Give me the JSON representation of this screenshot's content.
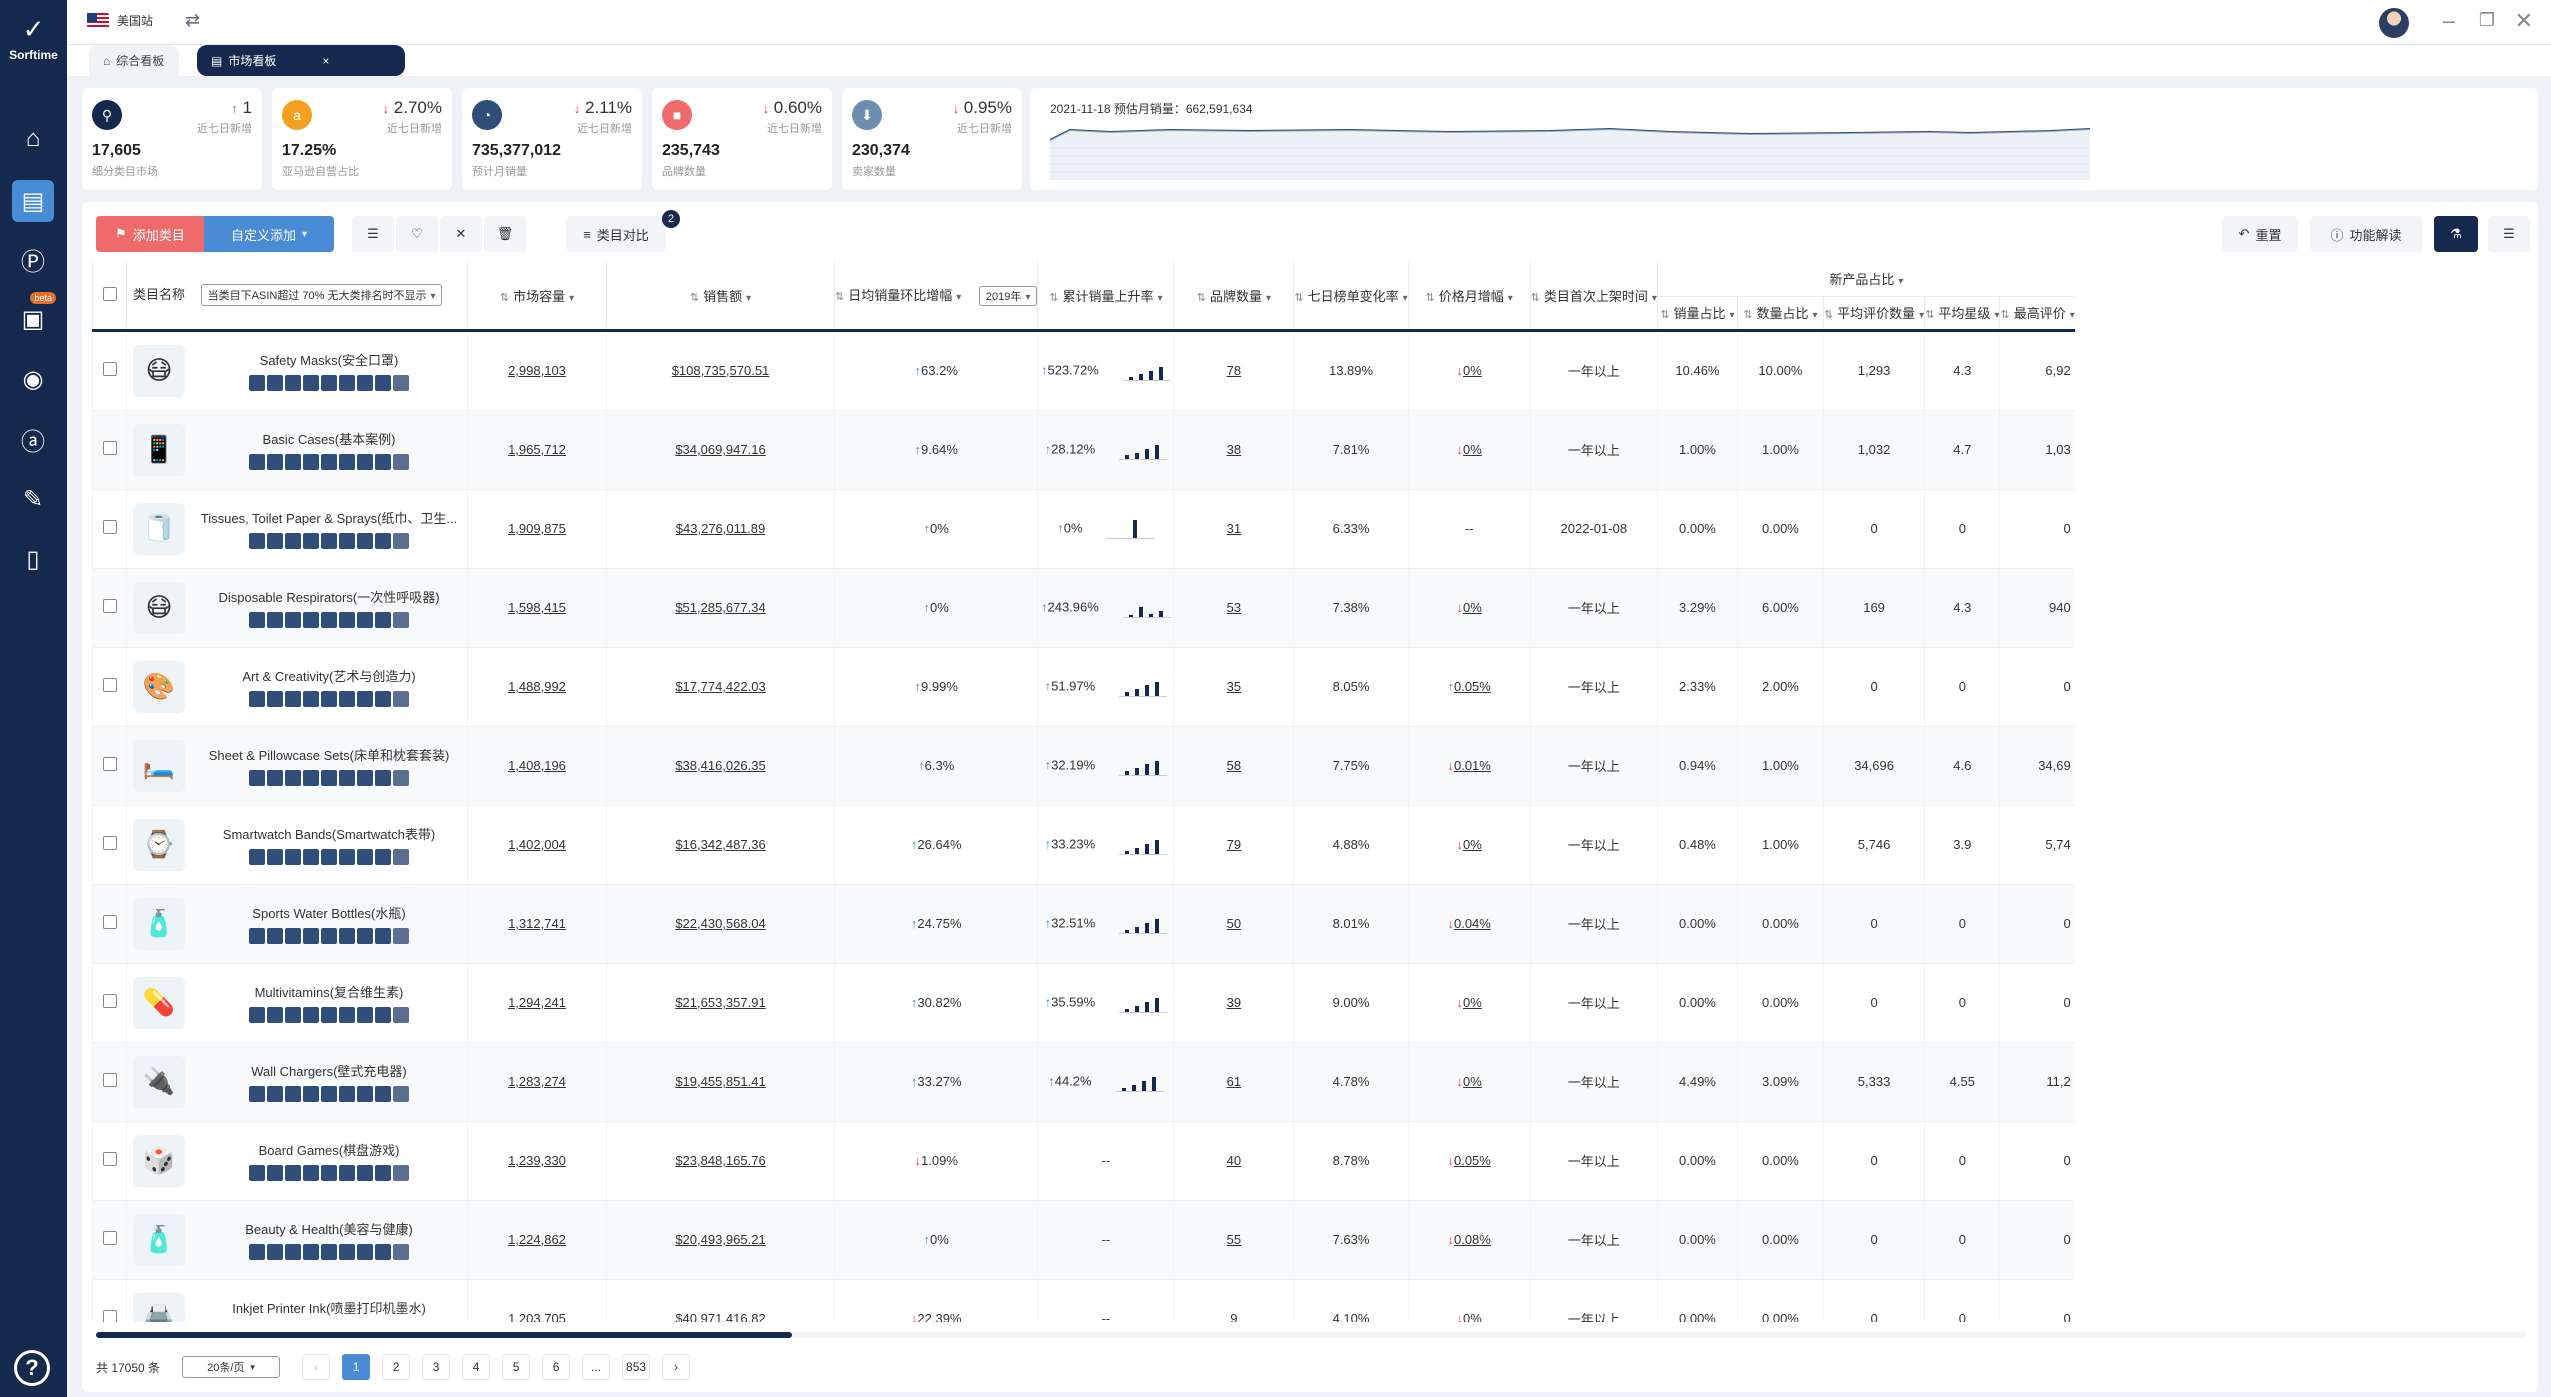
{
  "app": {
    "name": "Sorftime",
    "site": "美国站"
  },
  "tabs": [
    {
      "label": "综合看板"
    },
    {
      "label": "市场看板"
    }
  ],
  "stats": [
    {
      "icon": "market-icon",
      "arrow": "↑",
      "change": "1",
      "change_dir": "up",
      "sub": "近七日新增",
      "value": "17,605",
      "label": "细分类目市场",
      "color": "#15284d"
    },
    {
      "icon": "amazon-icon",
      "arrow": "↓",
      "change": "2.70%",
      "change_dir": "down",
      "sub": "近七日新增",
      "value": "17.25%",
      "label": "亚马逊自营占比",
      "color": "#f4a020"
    },
    {
      "icon": "sales-icon",
      "arrow": "↓",
      "change": "2.11%",
      "change_dir": "down",
      "sub": "近七日新增",
      "value": "735,377,012",
      "label": "预计月销量",
      "color": "#2f4f7a"
    },
    {
      "icon": "brand-icon",
      "arrow": "↓",
      "change": "0.60%",
      "change_dir": "down",
      "sub": "近七日新增",
      "value": "235,743",
      "label": "品牌数量",
      "color": "#ef6b6b"
    },
    {
      "icon": "seller-icon",
      "arrow": "↓",
      "change": "0.95%",
      "change_dir": "down",
      "sub": "近七日新增",
      "value": "230,374",
      "label": "卖家数量",
      "color": "#6d8eb0"
    }
  ],
  "trend": {
    "title": "2021-11-18 预估月销量：662,591,634"
  },
  "toolbar": {
    "add": "添加类目",
    "custom_add": "自定义添加",
    "compare": "类目对比",
    "compare_count": "2",
    "reset": "重置",
    "help": "功能解读"
  },
  "columns": {
    "name": "类目名称",
    "filter": "当类目下ASIN超过 70% 无大类排名时不显示",
    "capacity": "市场容量",
    "sales": "销售额",
    "daily_growth": "日均销量环比增幅",
    "year": "2019年",
    "cum_rate": "累计销量上升率",
    "brands": "品牌数量",
    "rank_change": "七日榜单变化率",
    "price_growth": "价格月增幅",
    "first_listed": "类目首次上架时间",
    "new_group": "新产品占比",
    "sub": [
      "销量占比",
      "数量占比",
      "平均评价数量",
      "平均星级",
      "最高评价"
    ]
  },
  "rows": [
    {
      "name": "Safety Masks(安全口罩)",
      "img": "😷",
      "capacity": "2,998,103",
      "sales": "$108,735,570.51",
      "dg_dir": "up",
      "dg": "63.2%",
      "cr_dir": "up",
      "cr": "523.72%",
      "spark": [
        3,
        6,
        9,
        13
      ],
      "brands": "78",
      "rank": "13.89%",
      "pg_dir": "down",
      "pg": "0%",
      "first": "一年以上",
      "s1": "10.46%",
      "s2": "10.00%",
      "s3": "1,293",
      "s4": "4.3",
      "s5": "6,92"
    },
    {
      "name": "Basic Cases(基本案例)",
      "img": "📱",
      "capacity": "1,965,712",
      "sales": "$34,069,947.16",
      "dg_dir": "up",
      "dg": "9.64%",
      "cr_dir": "up",
      "cr": "28.12%",
      "spark": [
        4,
        6,
        10,
        14
      ],
      "brands": "38",
      "rank": "7.81%",
      "pg_dir": "down",
      "pg": "0%",
      "first": "一年以上",
      "s1": "1.00%",
      "s2": "1.00%",
      "s3": "1,032",
      "s4": "4.7",
      "s5": "1,03"
    },
    {
      "name": "Tissues, Toilet Paper & Sprays(纸巾、卫生...",
      "img": "🧻",
      "capacity": "1,909,875",
      "sales": "$43,276,011.89",
      "dg_dir": "up",
      "dg": "0%",
      "cr_dir": "up",
      "cr": "0%",
      "spark": [
        0,
        0,
        18,
        0
      ],
      "brands": "31",
      "rank": "6.33%",
      "pg_dir": "none",
      "pg": "--",
      "first": "2022-01-08",
      "s1": "0.00%",
      "s2": "0.00%",
      "s3": "0",
      "s4": "0",
      "s5": "0"
    },
    {
      "name": "Disposable Respirators(一次性呼吸器)",
      "img": "😷",
      "capacity": "1,598,415",
      "sales": "$51,285,677.34",
      "dg_dir": "up",
      "dg": "0%",
      "cr_dir": "up",
      "cr": "243.96%",
      "spark": [
        2,
        10,
        3,
        6
      ],
      "brands": "53",
      "rank": "7.38%",
      "pg_dir": "down",
      "pg": "0%",
      "first": "一年以上",
      "s1": "3.29%",
      "s2": "6.00%",
      "s3": "169",
      "s4": "4.3",
      "s5": "940"
    },
    {
      "name": "Art & Creativity(艺术与创造力)",
      "img": "🎨",
      "capacity": "1,488,992",
      "sales": "$17,774,422.03",
      "dg_dir": "up",
      "dg": "9.99%",
      "cr_dir": "up",
      "cr": "51.97%",
      "spark": [
        4,
        7,
        11,
        14
      ],
      "brands": "35",
      "rank": "8.05%",
      "pg_dir": "up",
      "pg": "0.05%",
      "first": "一年以上",
      "s1": "2.33%",
      "s2": "2.00%",
      "s3": "0",
      "s4": "0",
      "s5": "0"
    },
    {
      "name": "Sheet & Pillowcase Sets(床单和枕套套装)",
      "img": "🛏️",
      "capacity": "1,408,196",
      "sales": "$38,416,026.35",
      "dg_dir": "up",
      "dg": "6.3%",
      "cr_dir": "up",
      "cr": "32.19%",
      "spark": [
        4,
        7,
        11,
        14
      ],
      "brands": "58",
      "rank": "7.75%",
      "pg_dir": "down",
      "pg": "0.01%",
      "first": "一年以上",
      "s1": "0.94%",
      "s2": "1.00%",
      "s3": "34,696",
      "s4": "4.6",
      "s5": "34,69"
    },
    {
      "name": "Smartwatch Bands(Smartwatch表带)",
      "img": "⌚",
      "capacity": "1,402,004",
      "sales": "$16,342,487.36",
      "dg_dir": "up",
      "dg": "26.64%",
      "cr_dir": "up",
      "cr": "33.23%",
      "spark": [
        3,
        6,
        10,
        14
      ],
      "brands": "79",
      "rank": "4.88%",
      "pg_dir": "down",
      "pg": "0%",
      "first": "一年以上",
      "s1": "0.48%",
      "s2": "1.00%",
      "s3": "5,746",
      "s4": "3.9",
      "s5": "5,74"
    },
    {
      "name": "Sports Water Bottles(水瓶)",
      "img": "🧴",
      "capacity": "1,312,741",
      "sales": "$22,430,568.04",
      "dg_dir": "up",
      "dg": "24.75%",
      "cr_dir": "up",
      "cr": "32.51%",
      "spark": [
        3,
        6,
        10,
        14
      ],
      "brands": "50",
      "rank": "8.01%",
      "pg_dir": "down",
      "pg": "0.04%",
      "first": "一年以上",
      "s1": "0.00%",
      "s2": "0.00%",
      "s3": "0",
      "s4": "0",
      "s5": "0"
    },
    {
      "name": "Multivitamins(复合维生素)",
      "img": "💊",
      "capacity": "1,294,241",
      "sales": "$21,653,357.91",
      "dg_dir": "up",
      "dg": "30.82%",
      "cr_dir": "up",
      "cr": "35.59%",
      "spark": [
        3,
        6,
        10,
        14
      ],
      "brands": "39",
      "rank": "9.00%",
      "pg_dir": "down",
      "pg": "0%",
      "first": "一年以上",
      "s1": "0.00%",
      "s2": "0.00%",
      "s3": "0",
      "s4": "0",
      "s5": "0"
    },
    {
      "name": "Wall Chargers(壁式充电器)",
      "img": "🔌",
      "capacity": "1,283,274",
      "sales": "$19,455,851.41",
      "dg_dir": "up",
      "dg": "33.27%",
      "cr_dir": "up",
      "cr": "44.2%",
      "spark": [
        3,
        6,
        10,
        14
      ],
      "brands": "61",
      "rank": "4.78%",
      "pg_dir": "down",
      "pg": "0%",
      "first": "一年以上",
      "s1": "4.49%",
      "s2": "3.09%",
      "s3": "5,333",
      "s4": "4.55",
      "s5": "11,2"
    },
    {
      "name": "Board Games(棋盘游戏)",
      "img": "🎲",
      "capacity": "1,239,330",
      "sales": "$23,848,165.76",
      "dg_dir": "down",
      "dg": "1.09%",
      "cr_dir": "none",
      "cr": "--",
      "spark": [],
      "brands": "40",
      "rank": "8.78%",
      "pg_dir": "down",
      "pg": "0.05%",
      "first": "一年以上",
      "s1": "0.00%",
      "s2": "0.00%",
      "s3": "0",
      "s4": "0",
      "s5": "0"
    },
    {
      "name": "Beauty & Health(美容与健康)",
      "img": "🧴",
      "capacity": "1,224,862",
      "sales": "$20,493,965.21",
      "dg_dir": "up",
      "dg": "0%",
      "cr_dir": "none",
      "cr": "--",
      "spark": [],
      "brands": "55",
      "rank": "7.63%",
      "pg_dir": "down",
      "pg": "0.08%",
      "first": "一年以上",
      "s1": "0.00%",
      "s2": "0.00%",
      "s3": "0",
      "s4": "0",
      "s5": "0"
    },
    {
      "name": "Inkjet Printer Ink(喷墨打印机墨水)",
      "img": "🖨️",
      "capacity": "1,203,705",
      "sales": "$40,971,416.82",
      "dg_dir": "down",
      "dg": "22.39%",
      "cr_dir": "none",
      "cr": "--",
      "spark": [],
      "brands": "9",
      "rank": "4.10%",
      "pg_dir": "down",
      "pg": "0%",
      "first": "一年以上",
      "s1": "0.00%",
      "s2": "0.00%",
      "s3": "0",
      "s4": "0",
      "s5": "0"
    }
  ],
  "pagination": {
    "total": "共 17050 条",
    "page_size": "20条/页",
    "pages": [
      "1",
      "2",
      "3",
      "4",
      "5",
      "6",
      "...",
      "853"
    ],
    "current": "1"
  }
}
